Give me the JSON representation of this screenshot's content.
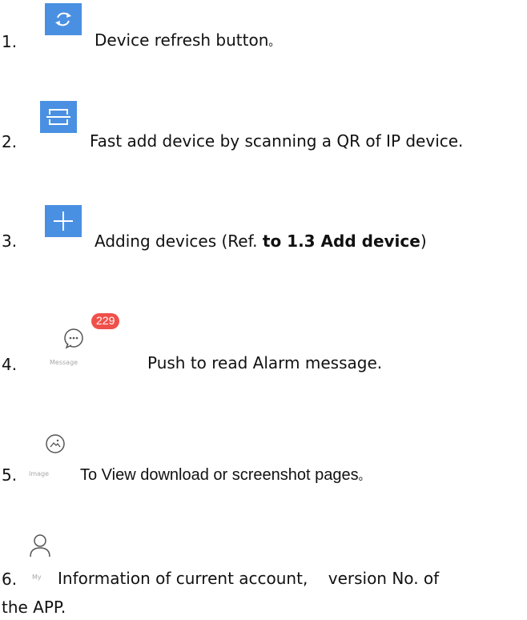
{
  "items": [
    {
      "num": "1.",
      "text": "Device refresh button",
      "suffix": "。",
      "icon": "refresh-icon"
    },
    {
      "num": "2.",
      "text": "Fast add device by scanning a QR of IP device.",
      "icon": "qr-scan-icon"
    },
    {
      "num": "3.",
      "text_pre": "Adding devices (Ref. ",
      "text_bold": "to 1.3 Add device",
      "text_post": ")",
      "icon": "plus-icon"
    },
    {
      "num": "4.",
      "label": "Message",
      "badge": "229",
      "text": "Push to read Alarm message.",
      "icon": "message-icon"
    },
    {
      "num": "5.",
      "label": "Image",
      "text": "To View download or screenshot pages",
      "suffix": "。",
      "icon": "image-icon"
    },
    {
      "num": "6.",
      "label": "My",
      "text": "Information of current account,    version No. of",
      "text2": "the APP.",
      "icon": "user-icon"
    }
  ],
  "colors": {
    "icon_blue": "#4a90e2",
    "badge_red": "#f0504a"
  }
}
